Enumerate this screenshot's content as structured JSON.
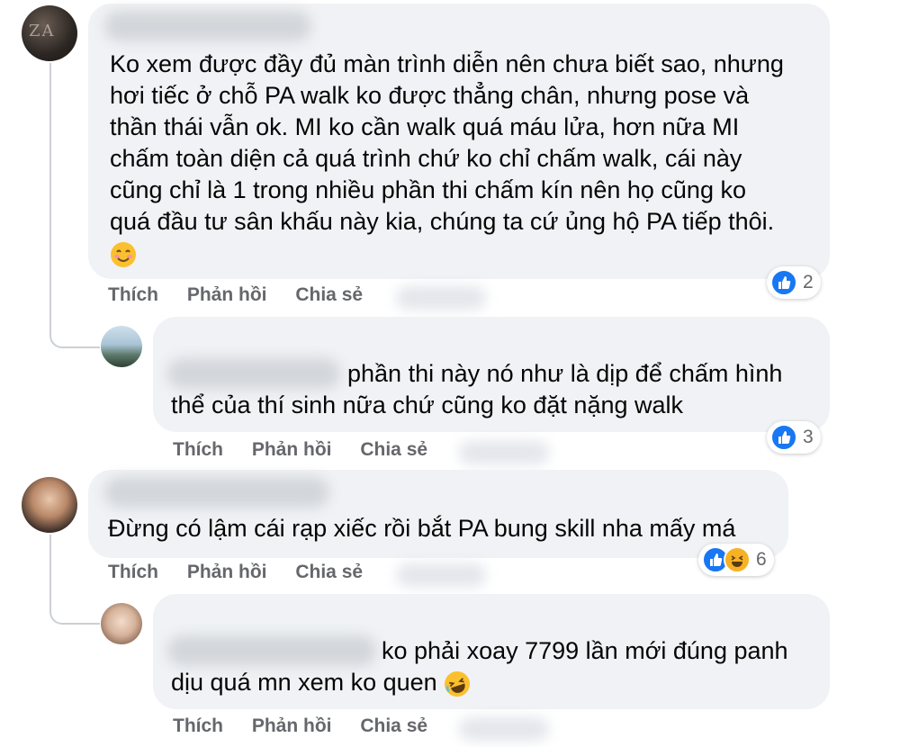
{
  "comments": [
    {
      "lines": [
        "Ko xem được đầy đủ màn trình diễn nên chưa biết sao, nhưng",
        "hơi tiếc ở chỗ PA walk ko được thẳng chân, nhưng pose và",
        "thần thái vẫn ok. MI ko cần walk quá máu lửa, hơn nữa MI",
        "chấm toàn diện cả quá trình chứ ko chỉ chấm walk, cái này",
        "cũng chỉ là 1 trong nhiều phần thi chấm kín nên họ cũng ko",
        "quá đầu tư sân khấu này kia, chúng ta cứ ủng hộ PA tiếp thôi."
      ],
      "emoji": "smiling-face-icon",
      "reaction_count": "2"
    },
    {
      "lines": [
        "phần thi này nó như là dịp để chấm hình",
        "thể của thí sinh nữa chứ cũng ko đặt nặng walk"
      ],
      "reaction_count": "3"
    },
    {
      "lines": [
        "Đừng có lậm cái rạp xiếc rồi bắt PA bung skill nha mấy má"
      ],
      "reaction_count": "6"
    },
    {
      "lines": [
        "ko phải xoay 7799 lần mới đúng panh",
        "dịu quá mn xem ko quen"
      ],
      "emoji": "laughing-face-icon"
    }
  ],
  "actions": {
    "like": "Thích",
    "reply": "Phản hồi",
    "share": "Chia sẻ"
  },
  "colors": {
    "bubble": "#f0f2f5",
    "like_blue": "#1877f2",
    "action_gray": "#65676b"
  }
}
